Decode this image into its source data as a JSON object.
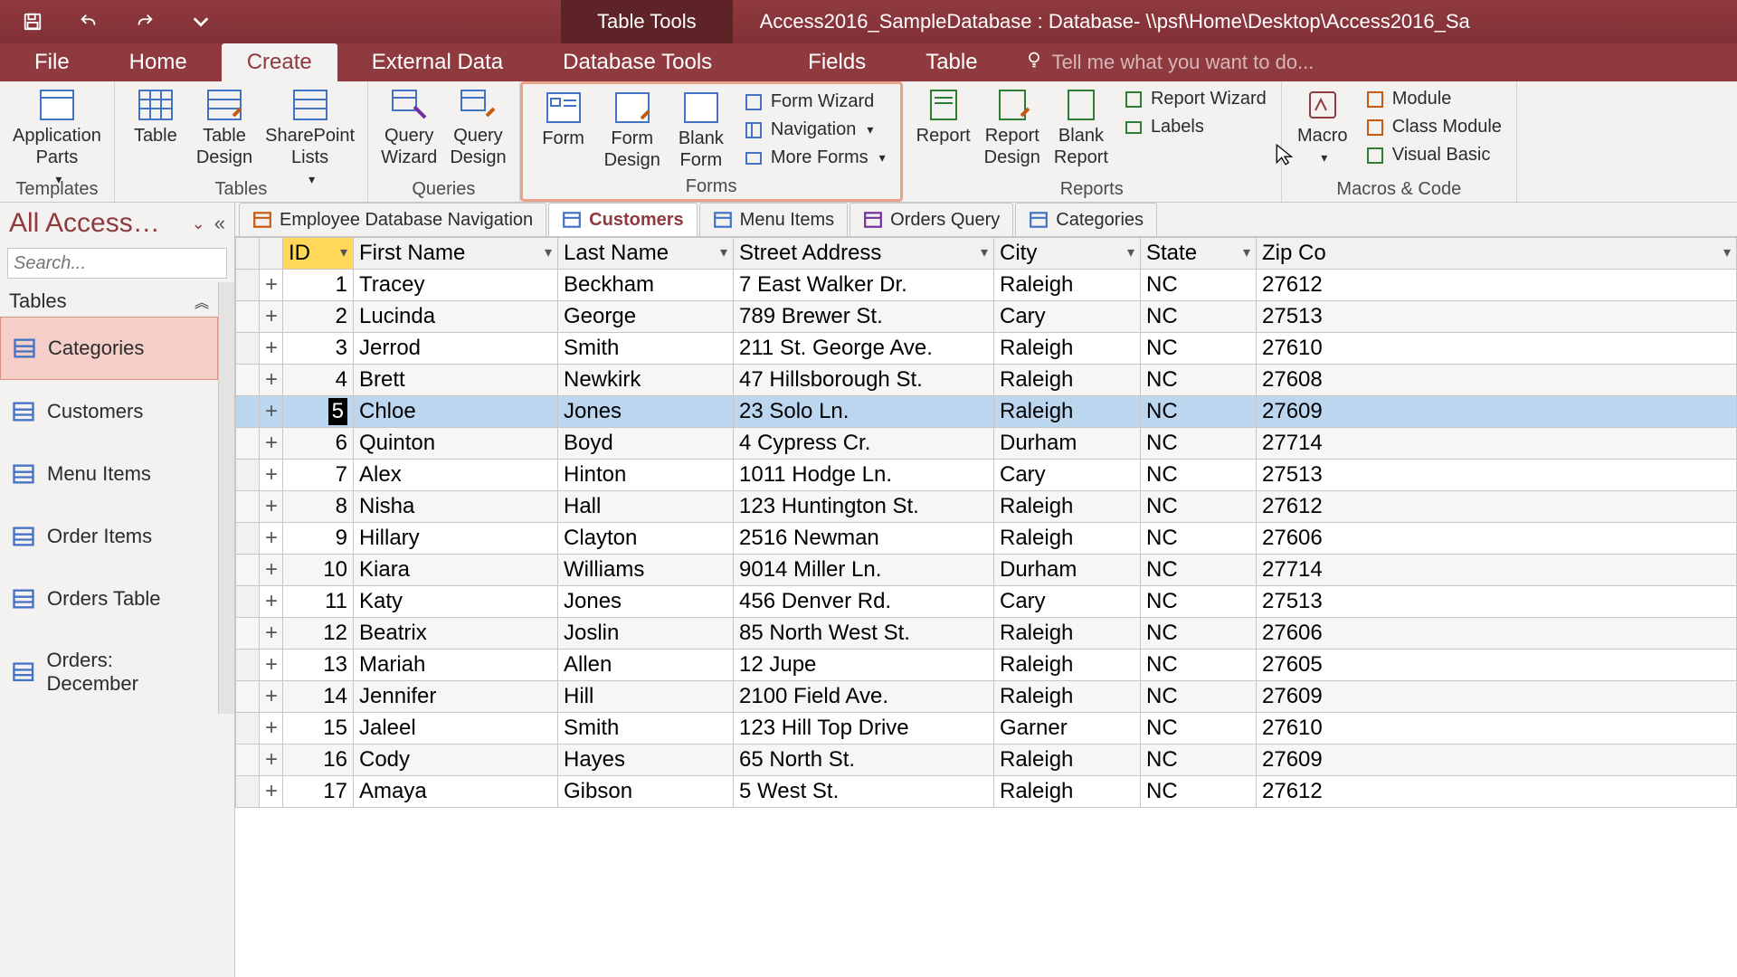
{
  "titlebar": {
    "tools_label": "Table Tools",
    "title": "Access2016_SampleDatabase : Database- \\\\psf\\Home\\Desktop\\Access2016_Sa"
  },
  "ribbon_tabs": {
    "file": "File",
    "home": "Home",
    "create": "Create",
    "external_data": "External Data",
    "database_tools": "Database Tools",
    "fields": "Fields",
    "table": "Table",
    "tellme_placeholder": "Tell me what you want to do..."
  },
  "ribbon": {
    "templates": {
      "application_parts": "Application\nParts",
      "label": "Templates"
    },
    "tables": {
      "table": "Table",
      "table_design": "Table\nDesign",
      "sharepoint_lists": "SharePoint\nLists",
      "label": "Tables"
    },
    "queries": {
      "query_wizard": "Query\nWizard",
      "query_design": "Query\nDesign",
      "label": "Queries"
    },
    "forms": {
      "form": "Form",
      "form_design": "Form\nDesign",
      "blank_form": "Blank\nForm",
      "form_wizard": "Form Wizard",
      "navigation": "Navigation",
      "more_forms": "More Forms",
      "label": "Forms"
    },
    "reports": {
      "report": "Report",
      "report_design": "Report\nDesign",
      "blank_report": "Blank\nReport",
      "report_wizard": "Report Wizard",
      "labels": "Labels",
      "label": "Reports"
    },
    "macros": {
      "macro": "Macro",
      "module": "Module",
      "class_module": "Class Module",
      "visual_basic": "Visual Basic",
      "label": "Macros & Code"
    }
  },
  "nav": {
    "title": "All Access…",
    "search_placeholder": "Search...",
    "section": "Tables",
    "items": [
      "Categories",
      "Customers",
      "Menu Items",
      "Order Items",
      "Orders Table",
      "Orders: December"
    ],
    "selected_index": 0
  },
  "obj_tabs": [
    {
      "label": "Employee Database Navigation",
      "kind": "form",
      "active": false
    },
    {
      "label": "Customers",
      "kind": "table",
      "active": true
    },
    {
      "label": "Menu Items",
      "kind": "table",
      "active": false
    },
    {
      "label": "Orders Query",
      "kind": "query",
      "active": false
    },
    {
      "label": "Categories",
      "kind": "table",
      "active": false
    }
  ],
  "columns": [
    "ID",
    "First Name",
    "Last Name",
    "Street Address",
    "City",
    "State",
    "Zip Co"
  ],
  "selected_col_index": 0,
  "current_row_index": 4,
  "rows": [
    {
      "id": 1,
      "first": "Tracey",
      "last": "Beckham",
      "addr": "7 East Walker Dr.",
      "city": "Raleigh",
      "state": "NC",
      "zip": "27612"
    },
    {
      "id": 2,
      "first": "Lucinda",
      "last": "George",
      "addr": "789 Brewer St.",
      "city": "Cary",
      "state": "NC",
      "zip": "27513"
    },
    {
      "id": 3,
      "first": "Jerrod",
      "last": "Smith",
      "addr": "211 St. George Ave.",
      "city": "Raleigh",
      "state": "NC",
      "zip": "27610"
    },
    {
      "id": 4,
      "first": "Brett",
      "last": "Newkirk",
      "addr": "47 Hillsborough St.",
      "city": "Raleigh",
      "state": "NC",
      "zip": "27608"
    },
    {
      "id": 5,
      "first": "Chloe",
      "last": "Jones",
      "addr": "23 Solo Ln.",
      "city": "Raleigh",
      "state": "NC",
      "zip": "27609"
    },
    {
      "id": 6,
      "first": "Quinton",
      "last": "Boyd",
      "addr": "4 Cypress Cr.",
      "city": "Durham",
      "state": "NC",
      "zip": "27714"
    },
    {
      "id": 7,
      "first": "Alex",
      "last": "Hinton",
      "addr": "1011 Hodge Ln.",
      "city": "Cary",
      "state": "NC",
      "zip": "27513"
    },
    {
      "id": 8,
      "first": "Nisha",
      "last": "Hall",
      "addr": "123 Huntington St.",
      "city": "Raleigh",
      "state": "NC",
      "zip": "27612"
    },
    {
      "id": 9,
      "first": "Hillary",
      "last": "Clayton",
      "addr": "2516 Newman",
      "city": "Raleigh",
      "state": "NC",
      "zip": "27606"
    },
    {
      "id": 10,
      "first": "Kiara",
      "last": "Williams",
      "addr": "9014 Miller Ln.",
      "city": "Durham",
      "state": "NC",
      "zip": "27714"
    },
    {
      "id": 11,
      "first": "Katy",
      "last": "Jones",
      "addr": "456 Denver Rd.",
      "city": "Cary",
      "state": "NC",
      "zip": "27513"
    },
    {
      "id": 12,
      "first": "Beatrix",
      "last": "Joslin",
      "addr": "85 North West St.",
      "city": "Raleigh",
      "state": "NC",
      "zip": "27606"
    },
    {
      "id": 13,
      "first": "Mariah",
      "last": "Allen",
      "addr": "12 Jupe",
      "city": "Raleigh",
      "state": "NC",
      "zip": "27605"
    },
    {
      "id": 14,
      "first": "Jennifer",
      "last": "Hill",
      "addr": "2100 Field Ave.",
      "city": "Raleigh",
      "state": "NC",
      "zip": "27609"
    },
    {
      "id": 15,
      "first": "Jaleel",
      "last": "Smith",
      "addr": "123 Hill Top Drive",
      "city": "Garner",
      "state": "NC",
      "zip": "27610"
    },
    {
      "id": 16,
      "first": "Cody",
      "last": "Hayes",
      "addr": "65 North St.",
      "city": "Raleigh",
      "state": "NC",
      "zip": "27609"
    },
    {
      "id": 17,
      "first": "Amaya",
      "last": "Gibson",
      "addr": "5 West St.",
      "city": "Raleigh",
      "state": "NC",
      "zip": "27612"
    }
  ]
}
